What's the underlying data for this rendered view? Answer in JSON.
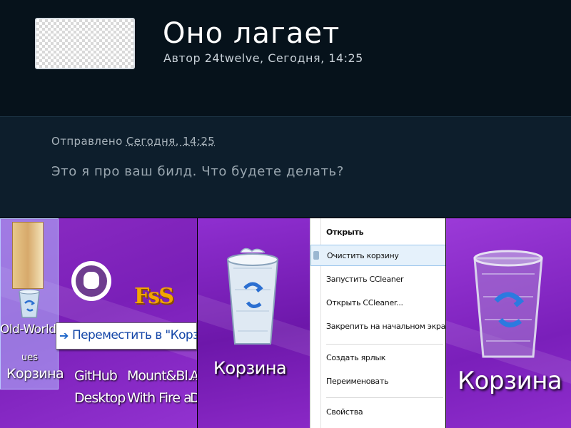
{
  "topic": {
    "title": "Оно лагает",
    "meta": "Автор 24twelve, Сегодня, 14:25"
  },
  "post": {
    "sent_prefix": "Отправлено",
    "sent_date": "Сегодня, 14:25",
    "body": "Это я про ваш билд. Что будете делать?"
  },
  "desktop": {
    "overlay_name": "Old-World-B",
    "overlay_sub": "ues",
    "bin_label": "Корзина",
    "github_label_line1": "GitHub",
    "github_label_line2": "Desktop",
    "mount_label_line1": "Mount&Bl...",
    "mount_label_line2": "With Fire a...",
    "cut_label_line1": "A",
    "cut_label_line2": "D",
    "fs_logo": "FsS",
    "drag_tooltip": "Переместить в \"Корзина\""
  },
  "bin_panel_2": {
    "label": "Корзина"
  },
  "context_menu": {
    "items": [
      {
        "label": "Открыть",
        "bold": true
      },
      {
        "label": "Очистить корзину",
        "hover": true
      },
      {
        "label": "Запустить CCleaner"
      },
      {
        "label": "Открыть CCleaner..."
      },
      {
        "label": "Закрепить на начальном экране"
      },
      {
        "label": "Создать ярлык"
      },
      {
        "label": "Переименовать"
      },
      {
        "label": "Свойства"
      }
    ]
  },
  "bin_panel_4": {
    "label": "Корзина"
  },
  "colors": {
    "header_bg": "#06121b",
    "post_bg": "#0d1e2c",
    "desktop_purple": "#7a1fb8",
    "menu_hover": "#e5f1fb"
  }
}
